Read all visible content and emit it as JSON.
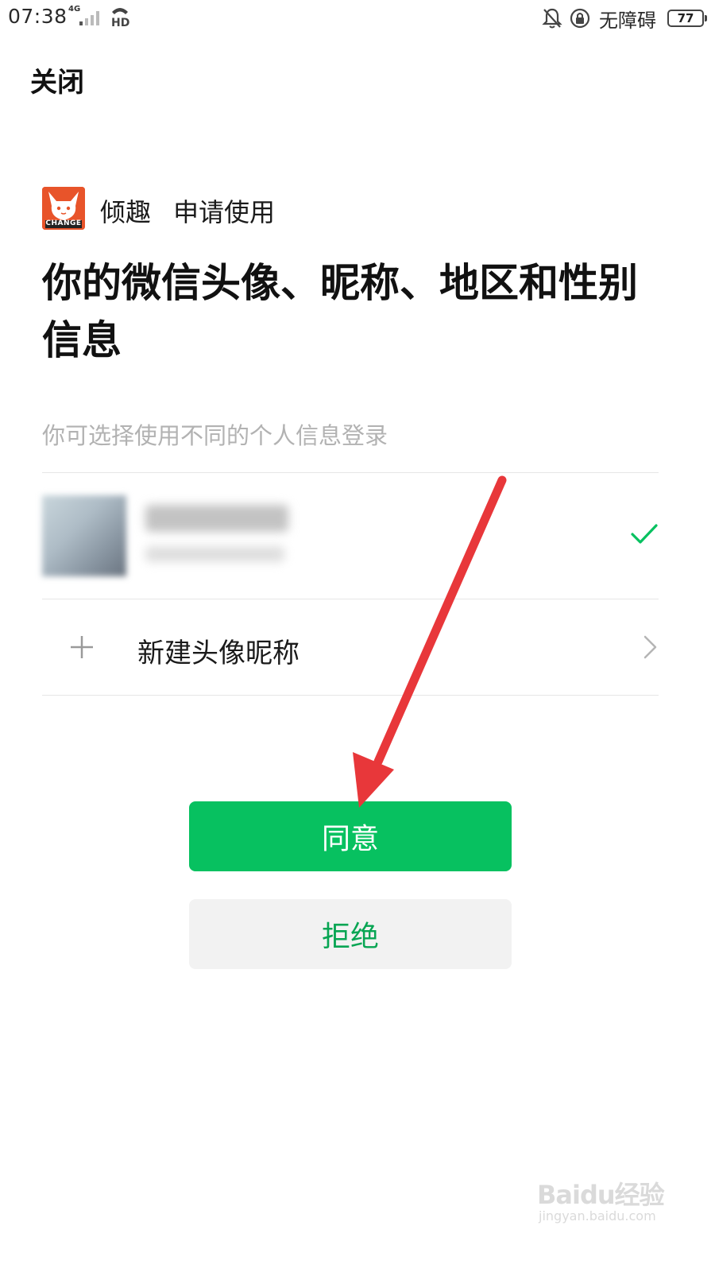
{
  "status_bar": {
    "time": "07:38",
    "network": "4G",
    "accessibility": "无障碍",
    "battery": "77"
  },
  "nav": {
    "close": "关闭"
  },
  "app": {
    "name": "倾趣",
    "request": "申请使用",
    "logo_text": "CHANGE"
  },
  "permission": {
    "title": "你的微信头像、昵称、地区和性别信息",
    "subtitle": "你可选择使用不同的个人信息登录"
  },
  "profiles": {
    "new_label": "新建头像昵称"
  },
  "actions": {
    "agree": "同意",
    "reject": "拒绝"
  },
  "watermark": {
    "brand": "Baidu经验",
    "url": "jingyan.baidu.com"
  },
  "colors": {
    "primary": "#07c160",
    "reject_bg": "#f2f2f2",
    "annotation_arrow": "#e8373a"
  }
}
